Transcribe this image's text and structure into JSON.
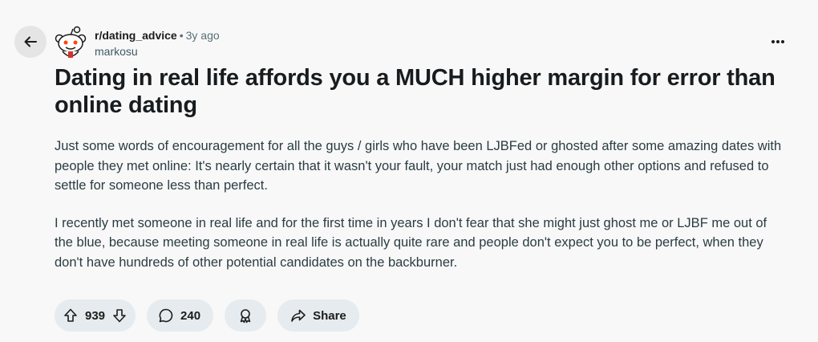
{
  "post": {
    "subreddit": "r/dating_advice",
    "separator": "•",
    "age": "3y ago",
    "author": "markosu",
    "title": "Dating in real life affords you a MUCH higher margin for error than online dating",
    "paragraphs": [
      "Just some words of encouragement for all the guys / girls who have been LJBFed or ghosted after some amazing dates with people they met online: It's nearly certain that it wasn't your fault, your match just had enough other options and refused to settle for someone less than perfect.",
      "I recently met someone in real life and for the first time in years I don't fear that she might just ghost me or LJBF me out of the blue, because meeting someone in real life is actually quite rare and people don't expect you to be perfect, when they don't have hundreds of other potential candidates on the backburner."
    ]
  },
  "actions": {
    "votes": "939",
    "comments": "240",
    "share_label": "Share"
  },
  "icons": {
    "back": "arrow-left-icon",
    "more": "ellipsis-icon",
    "upvote": "arrow-up-icon",
    "downvote": "arrow-down-icon",
    "comment": "chat-bubble-icon",
    "award": "award-icon",
    "share": "share-arrow-icon"
  }
}
